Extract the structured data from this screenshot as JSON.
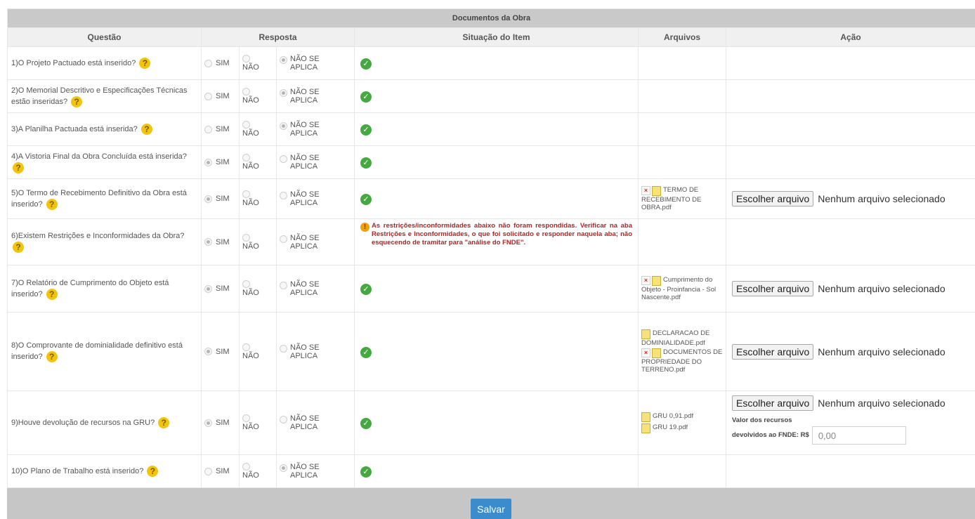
{
  "table": {
    "caption": "Documentos da Obra",
    "headers": {
      "questao": "Questão",
      "resposta": "Resposta",
      "situacao": "Situação do Item",
      "arquivos": "Arquivos",
      "acao": "Ação"
    },
    "options": {
      "sim": "SIM",
      "nao": "NÃO",
      "na_line1": "NÃO SE",
      "na_line2": "APLICA"
    },
    "rows": [
      {
        "question": "1)O Projeto Pactuado está inserido?",
        "selected": "na"
      },
      {
        "question": "2)O Memorial Descritivo e Especificações Técnicas estão inseridas?",
        "selected": "na"
      },
      {
        "question": "3)A Planilha Pactuada está inserida?",
        "selected": "na"
      },
      {
        "question": "4)A Vistoria Final da Obra Concluída está inserida?",
        "selected": "sim"
      },
      {
        "question": "5)O Termo de Recebimento Definitivo da Obra está inserido?",
        "selected": "sim",
        "files": [
          "TERMO DE RECEBIMENTO DE OBRA.pdf"
        ]
      },
      {
        "question": "6)Existem Restrições e Inconformidades da Obra?",
        "selected": "sim",
        "warning": "As restrições/inconformidades abaixo não foram respondidas. Verificar na aba Restrições e Inconformidades, o que foi solicitado e responder naquela aba; não esquecendo de tramitar para \"análise do FNDE\"."
      },
      {
        "question": "7)O Relatório de Cumprimento do Objeto está inserido?",
        "selected": "sim",
        "files": [
          "Cumprimento do Objeto - Proinfancia - Sol Nascente.pdf"
        ]
      },
      {
        "question": "8)O Comprovante de dominialidade definitivo está inserido?",
        "selected": "sim",
        "files": [
          "DECLARACAO DE DOMINIALIDADE.pdf",
          "DOCUMENTOS DE PROPRIEDADE DO TERRENO.pdf"
        ]
      },
      {
        "question": "9)Houve devolução de recursos na GRU?",
        "selected": "sim",
        "files": [
          "GRU 0,91.pdf",
          "GRU 19.pdf"
        ]
      },
      {
        "question": "10)O Plano de Trabalho está inserido?",
        "selected": "na"
      }
    ]
  },
  "upload": {
    "button_label": "Escolher arquivo",
    "no_file_text": "Nenhum arquivo selecionado"
  },
  "valor": {
    "label_line1": "Valor dos recursos",
    "label_line2": "devolvidos ao FNDE: R$",
    "value": "0,00"
  },
  "footer": {
    "save_label": "Salvar"
  },
  "icons": {
    "help": "question-help-icon",
    "ok": "check-circle-icon",
    "warning": "warning-icon",
    "delete": "delete-file-icon",
    "document": "document-icon"
  },
  "colors": {
    "ok_green": "#45a840",
    "warning_red": "#b32424",
    "save_blue": "#3a8ccd",
    "help_yellow": "#f3c40c"
  }
}
